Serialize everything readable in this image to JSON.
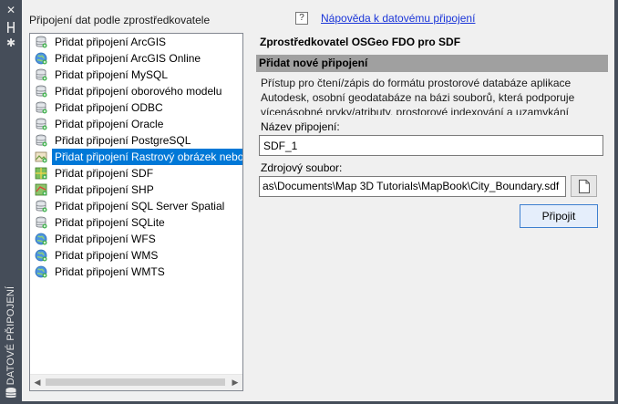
{
  "palette": {
    "title": "DATOVÉ PŘIPOJENÍ",
    "icons": [
      "close-icon",
      "pin-icon",
      "settings-icon",
      "database-icon"
    ]
  },
  "left_panel": {
    "title": "Připojení dat podle zprostředkovatele",
    "selected_index": 7,
    "items": [
      {
        "label": "Přidat připojení ArcGIS",
        "icon": "database-icon"
      },
      {
        "label": "Přidat připojení ArcGIS Online",
        "icon": "globe-icon"
      },
      {
        "label": "Přidat připojení MySQL",
        "icon": "database-icon"
      },
      {
        "label": "Přidat připojení oborového modelu",
        "icon": "database-icon"
      },
      {
        "label": "Přidat připojení ODBC",
        "icon": "database-icon"
      },
      {
        "label": "Přidat připojení Oracle",
        "icon": "database-icon"
      },
      {
        "label": "Přidat připojení PostgreSQL",
        "icon": "database-icon"
      },
      {
        "label": "Přidat připojení Rastrový obrázek nebo povrch",
        "icon": "raster-icon"
      },
      {
        "label": "Přidat připojení SDF",
        "icon": "sdf-icon"
      },
      {
        "label": "Přidat připojení SHP",
        "icon": "shp-icon"
      },
      {
        "label": "Přidat připojení SQL Server Spatial",
        "icon": "database-icon"
      },
      {
        "label": "Přidat připojení SQLite",
        "icon": "database-icon"
      },
      {
        "label": "Přidat připojení WFS",
        "icon": "globe-icon"
      },
      {
        "label": "Přidat připojení WMS",
        "icon": "globe-icon"
      },
      {
        "label": "Přidat připojení WMTS",
        "icon": "globe-icon"
      }
    ]
  },
  "right_panel": {
    "help_link": "Nápověda k datovému připojení",
    "provider_title": "Zprostředkovatel OSGeo FDO pro SDF",
    "section_title": "Přidat nové připojení",
    "description": "Přístup pro čtení/zápis do formátu prostorové databáze aplikace Autodesk, osobní geodatabáze na bázi souborů, která podporuje vícenásobné prvky/atributy, prostorové indexování a uzamykání souborů.",
    "connection_name_label": "Název připojení:",
    "connection_name_value": "SDF_1",
    "source_file_label": "Zdrojový soubor:",
    "source_file_value": "as\\Documents\\Map 3D Tutorials\\MapBook\\City_Boundary.sdf",
    "connect_button": "Připojit"
  },
  "colors": {
    "strip": "#454d59",
    "selection": "#0078d7",
    "section_bar": "#a0a0a0",
    "link": "#1a35d8"
  }
}
